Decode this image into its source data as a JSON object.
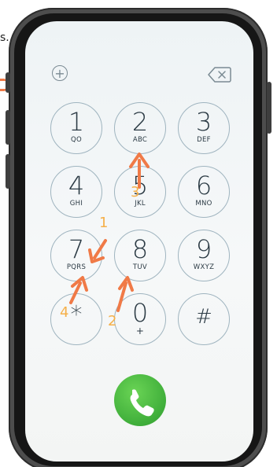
{
  "edge_fragment": "s.",
  "colors": {
    "accent_arrow": "#f07a47",
    "step_number": "#f5b04a",
    "key_ring": "#9fb4bf",
    "call_green": "#3fae3a"
  },
  "icons": {
    "add": "plus-circle-icon",
    "delete": "backspace-icon",
    "call": "phone-handset-icon"
  },
  "plus_glyph": "+",
  "keypad": {
    "keys": [
      {
        "digit": "1",
        "letters": "QO"
      },
      {
        "digit": "2",
        "letters": "ABC"
      },
      {
        "digit": "3",
        "letters": "DEF"
      },
      {
        "digit": "4",
        "letters": "GHI"
      },
      {
        "digit": "5",
        "letters": "JKL"
      },
      {
        "digit": "6",
        "letters": "MNO"
      },
      {
        "digit": "7",
        "letters": "PQRS"
      },
      {
        "digit": "8",
        "letters": "TUV"
      },
      {
        "digit": "9",
        "letters": "WXYZ"
      },
      {
        "digit": "*",
        "letters": ""
      },
      {
        "digit": "0",
        "letters": "+"
      },
      {
        "digit": "#",
        "letters": ""
      }
    ]
  },
  "steps": [
    "1",
    "2",
    "3",
    "4"
  ]
}
